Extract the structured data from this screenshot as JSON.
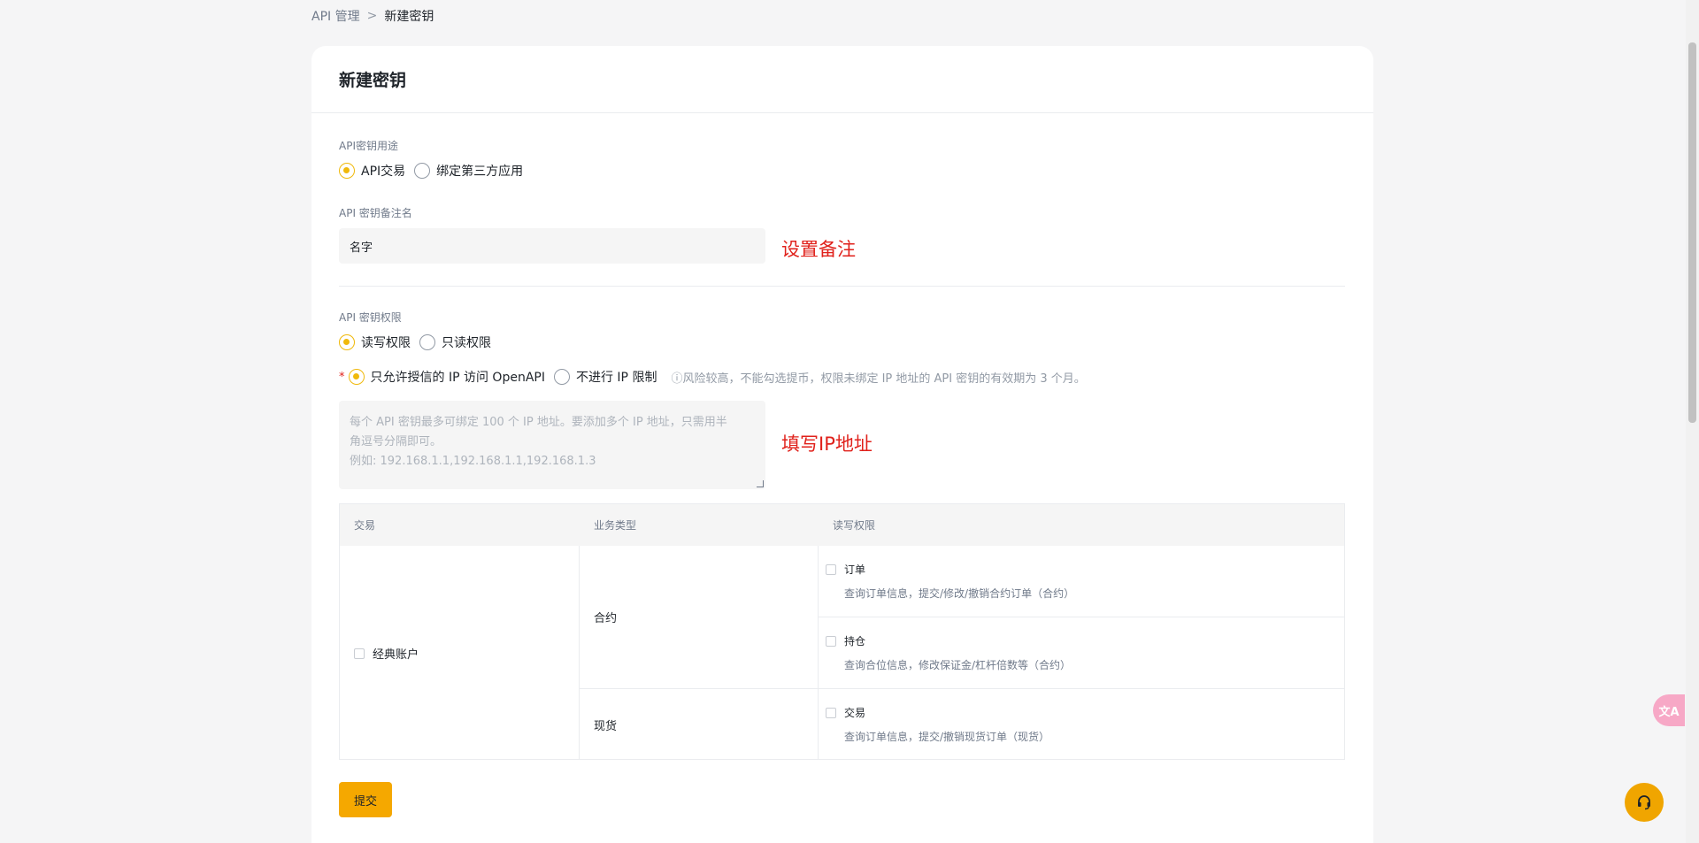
{
  "breadcrumb": {
    "parent": "API 管理",
    "separator": ">",
    "current": "新建密钥"
  },
  "card": {
    "title": "新建密钥"
  },
  "usage": {
    "label": "API密钥用途",
    "options": [
      {
        "label": "API交易",
        "checked": true
      },
      {
        "label": "绑定第三方应用",
        "checked": false
      }
    ]
  },
  "remark": {
    "label": "API 密钥备注名",
    "value": "名字",
    "annotation": "设置备注"
  },
  "permission": {
    "label": "API 密钥权限",
    "options": [
      {
        "label": "读写权限",
        "checked": true
      },
      {
        "label": "只读权限",
        "checked": false
      }
    ],
    "ip_options": [
      {
        "label": "只允许授信的 IP 访问 OpenAPI",
        "checked": true
      },
      {
        "label": "不进行 IP 限制",
        "checked": false
      }
    ],
    "required_mark": "*",
    "ip_hint": "ⓘ风险较高，不能勾选提币，权限未绑定 IP 地址的 API 密钥的有效期为 3 个月。",
    "ip_placeholder_line1": "每个 API 密钥最多可绑定 100 个 IP 地址。要添加多个 IP 地址，只需用半",
    "ip_placeholder_line2": "角逗号分隔即可。",
    "ip_placeholder_line3": "例如: 192.168.1.1,192.168.1.1,192.168.1.3",
    "ip_annotation": "填写IP地址"
  },
  "table": {
    "headers": [
      "交易",
      "业务类型",
      "读写权限"
    ],
    "account": "经典账户",
    "biz_types": [
      "合约",
      "现货"
    ],
    "perms": [
      {
        "title": "订单",
        "desc": "查询订单信息，提交/修改/撤销合约订单（合约）"
      },
      {
        "title": "持仓",
        "desc": "查询合位信息，修改保证金/杠杆倍数等（合约）"
      },
      {
        "title": "交易",
        "desc": "查询订单信息，提交/撤销现货订单（现货）"
      }
    ]
  },
  "submit_label": "提交",
  "translate_icon_text": "文A",
  "colors": {
    "accent": "#f0b90b",
    "annotation": "#e0211b",
    "button": "#f5a800"
  }
}
